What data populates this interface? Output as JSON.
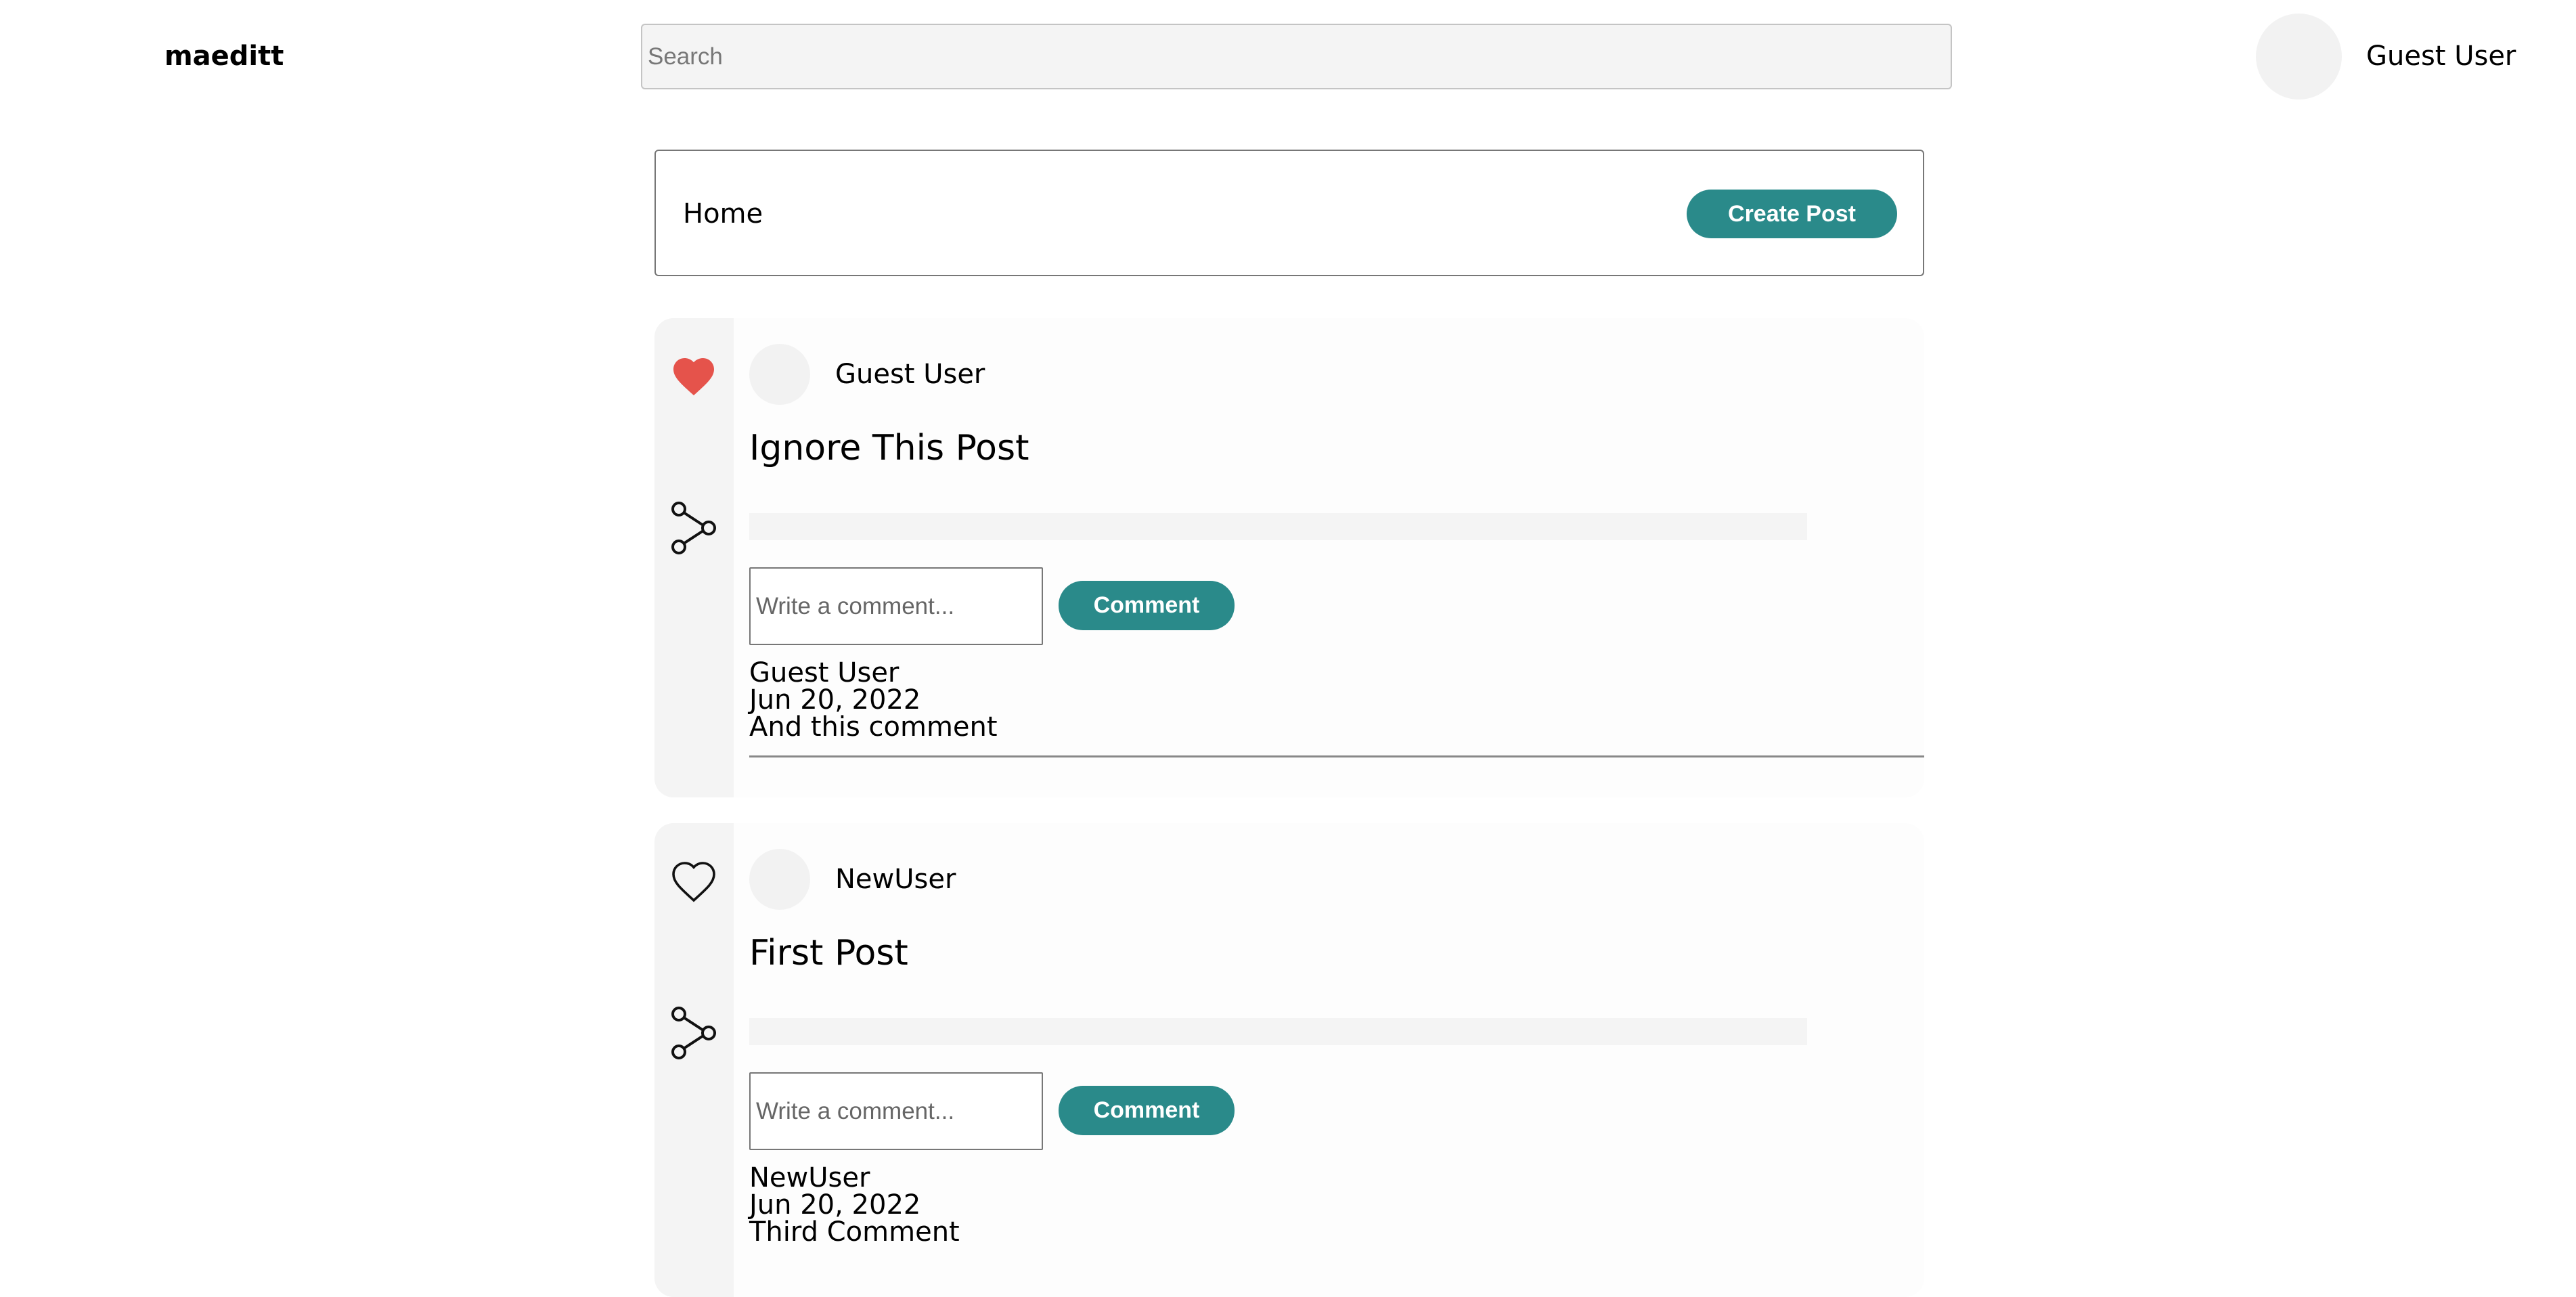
{
  "nav": {
    "logo": "maeditt",
    "search_placeholder": "Search",
    "user_name": "Guest User"
  },
  "home": {
    "title": "Home",
    "create_post_label": "Create Post"
  },
  "posts": [
    {
      "liked": true,
      "author": "Guest User",
      "title": "Ignore This Post",
      "comment_placeholder": "Write a comment...",
      "comment_button": "Comment",
      "comments": [
        {
          "author": "Guest User",
          "date": "Jun 20, 2022",
          "text": "And this comment"
        }
      ]
    },
    {
      "liked": false,
      "author": "NewUser",
      "title": "First Post",
      "comment_placeholder": "Write a comment...",
      "comment_button": "Comment",
      "comments": [
        {
          "author": "NewUser",
          "date": "Jun 20, 2022",
          "text": "Third Comment"
        }
      ]
    }
  ],
  "icons": {
    "like_filled": "heart-filled-icon",
    "like_outline": "heart-outline-icon",
    "share": "share-icon"
  },
  "colors": {
    "accent": "#2a8a8a",
    "like": "#e5534b"
  }
}
